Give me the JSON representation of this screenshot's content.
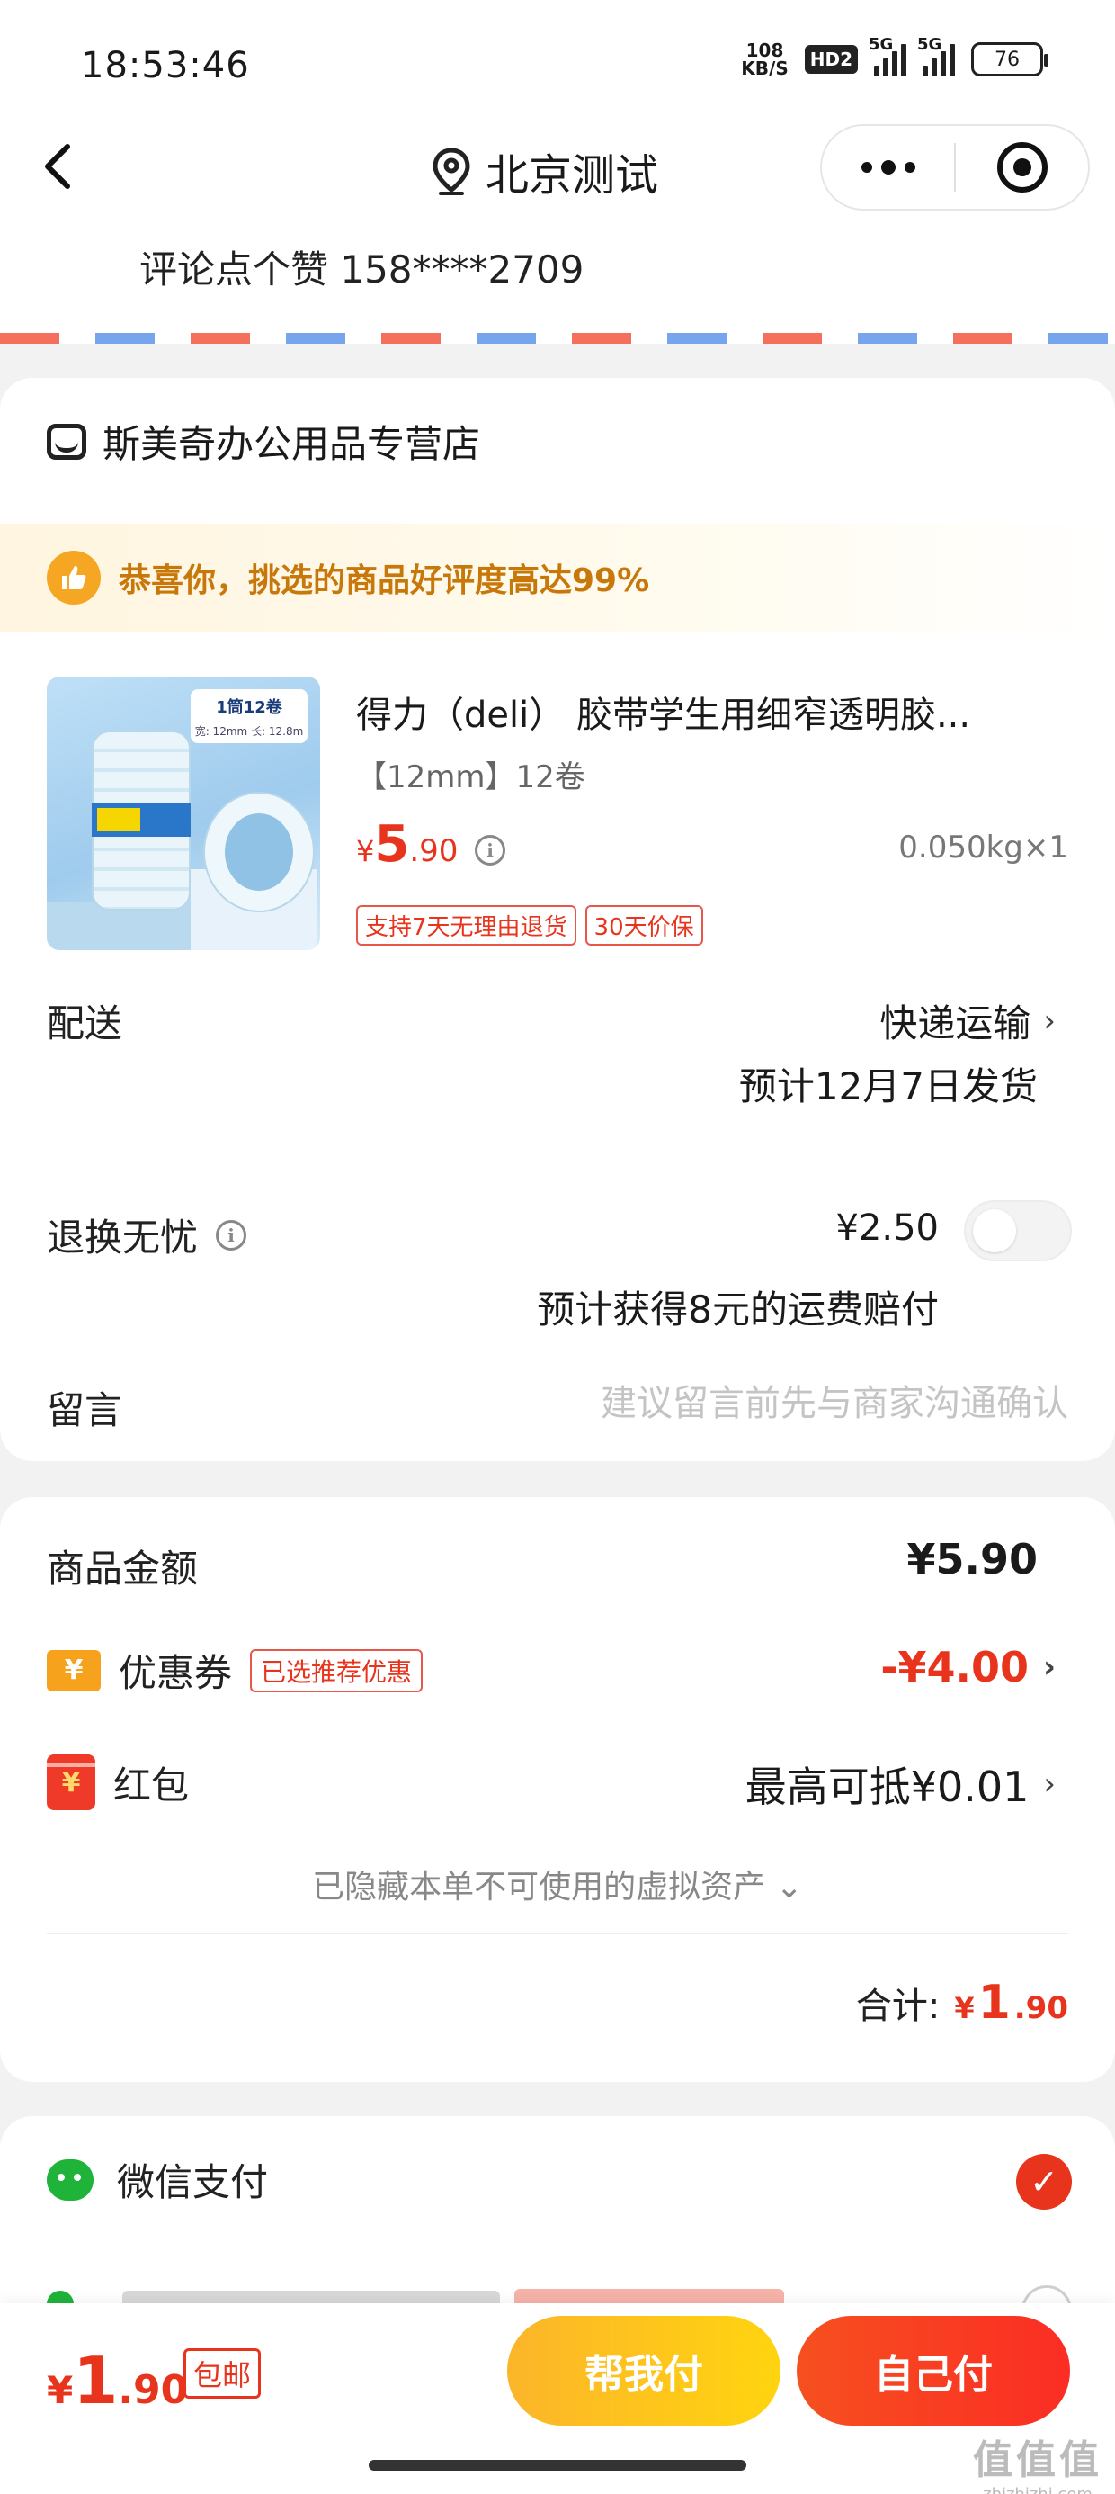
{
  "status_bar": {
    "time": "18:53:46",
    "net_speed_value": "108",
    "net_speed_unit": "KB/S",
    "hd_label": "HD2",
    "signal1_label": "5G",
    "signal2_label": "5G",
    "battery": "76"
  },
  "nav": {
    "title": "北京测试"
  },
  "address": {
    "text": "评论点个赞 158****2709"
  },
  "shop": {
    "name": "斯美奇办公用品专营店"
  },
  "praise_banner": {
    "text": "恭喜你，挑选的商品好评度高达99%"
  },
  "product": {
    "title": "得力（deli） 胶带学生用细窄透明胶...",
    "spec": "【12mm】12卷",
    "price_currency": "¥",
    "price_int": "5",
    "price_dec": ".90",
    "weight_qty": "0.050kg×1",
    "tags": [
      "支持7天无理由退货",
      "30天价保"
    ],
    "image_label": "1筒12卷",
    "image_sub": "宽: 12mm 长: 12.8m"
  },
  "delivery": {
    "label": "配送",
    "method": "快递运输",
    "eta": "预计12月7日发货"
  },
  "return_service": {
    "label": "退换无忧",
    "price": "¥2.50",
    "enabled": false,
    "note": "预计获得8元的运费赔付"
  },
  "message": {
    "label": "留言",
    "placeholder": "建议留言前先与商家沟通确认"
  },
  "summary": {
    "subtotal_label": "商品金额",
    "subtotal_value": "¥5.90",
    "coupon_label": "优惠券",
    "coupon_badge": "已选推荐优惠",
    "coupon_value": "-¥4.00",
    "redpacket_label": "红包",
    "redpacket_value": "最高可抵¥0.01",
    "hidden_assets": "已隐藏本单不可使用的虚拟资产",
    "total_label": "合计:",
    "total_currency": "¥",
    "total_int": "1",
    "total_dec": ".90"
  },
  "payment": {
    "wechat_label": "微信支付",
    "selected": true
  },
  "bottom_bar": {
    "price_currency": "¥",
    "price_int": "1",
    "price_dec": ".90",
    "free_shipping": "包邮",
    "help_pay_label": "帮我付",
    "self_pay_label": "自己付"
  },
  "watermark": {
    "main": "值值值",
    "sub": "zhizhizhi.com"
  },
  "colors": {
    "accent_red": "#e8341c",
    "help_button": "#fcb52a",
    "wechat_green": "#1fb33a",
    "praise_text": "#c8780a"
  },
  "icons": {
    "back": "chevron-left-icon",
    "location": "location-pin-icon",
    "more": "more-dots-icon",
    "close_miniapp": "target-icon",
    "shop": "shop-icon",
    "praise": "thumbs-up-icon",
    "info": "info-icon",
    "coupon": "coupon-icon",
    "redpacket": "red-packet-icon",
    "wechat": "wechat-icon",
    "check": "check-icon"
  }
}
